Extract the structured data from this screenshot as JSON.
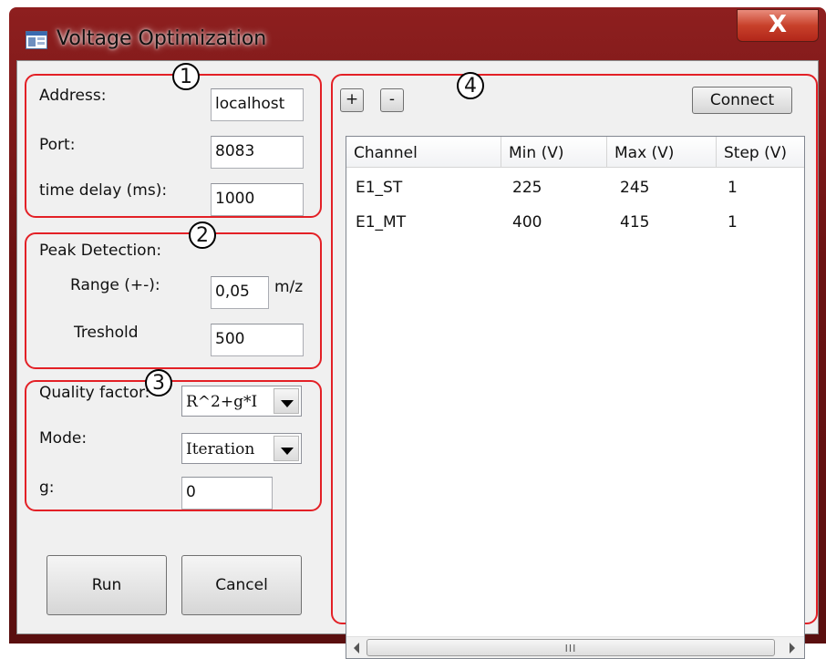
{
  "window": {
    "title": "Voltage Optimization",
    "close_glyph": "X",
    "icon": "app-window-icon"
  },
  "connection": {
    "badge": "1",
    "address_label": "Address:",
    "address_value": "localhost",
    "port_label": "Port:",
    "port_value": "8083",
    "delay_label": "time delay (ms):",
    "delay_value": "1000"
  },
  "peak": {
    "badge": "2",
    "heading": "Peak Detection:",
    "range_label": "Range (+-):",
    "range_value": "0,05",
    "range_unit": "m/z",
    "threshold_label": "Treshold",
    "threshold_value": "500"
  },
  "quality": {
    "badge": "3",
    "factor_label": "Quality factor:",
    "factor_value": "R^2+g*I",
    "mode_label": "Mode:",
    "mode_value": "Iteration",
    "g_label": "g:",
    "g_value": "0"
  },
  "actions": {
    "run_label": "Run",
    "cancel_label": "Cancel"
  },
  "channels": {
    "badge": "4",
    "add_label": "+",
    "remove_label": "-",
    "connect_label": "Connect",
    "columns": [
      "Channel",
      "Min (V)",
      "Max (V)",
      "Step (V)"
    ],
    "rows": [
      [
        "E1_ST",
        "225",
        "245",
        "1"
      ],
      [
        "E1_MT",
        "400",
        "415",
        "1"
      ]
    ],
    "scroll_grip": "III"
  },
  "colors": {
    "annotation_red": "#e32026",
    "frame_red": "#7a1717"
  }
}
